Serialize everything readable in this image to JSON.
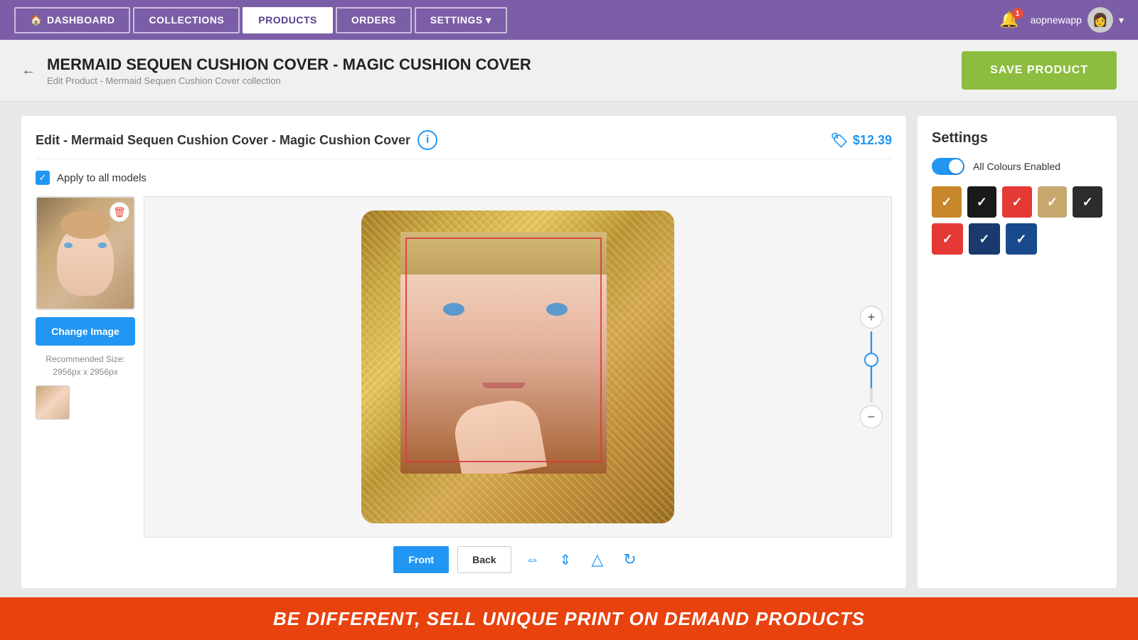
{
  "nav": {
    "items": [
      {
        "label": "DASHBOARD",
        "id": "dashboard",
        "active": false,
        "icon": "🏠"
      },
      {
        "label": "COLLECTIONS",
        "id": "collections",
        "active": false
      },
      {
        "label": "PRODUCTS",
        "id": "products",
        "active": true
      },
      {
        "label": "ORDERS",
        "id": "orders",
        "active": false
      },
      {
        "label": "SETTINGS ▾",
        "id": "settings",
        "active": false
      }
    ],
    "username": "aopnewapp",
    "notification_count": "1"
  },
  "breadcrumb": {
    "title": "MERMAID SEQUEN CUSHION COVER - MAGIC CUSHION COVER",
    "subtitle": "Edit Product - Mermaid Sequen Cushion Cover collection",
    "save_label": "SAVE PRODUCT"
  },
  "editor": {
    "title": "Edit - Mermaid Sequen Cushion Cover - Magic Cushion Cover",
    "price": "$12.39",
    "apply_all_label": "Apply to all models",
    "change_image_label": "Change Image",
    "rec_size_label": "Recommended Size:",
    "rec_size_value": "2956px x 2956px",
    "front_tab": "Front",
    "back_tab": "Back"
  },
  "settings": {
    "title": "Settings",
    "all_colours_label": "All Colours Enabled",
    "colors": [
      {
        "id": "gold",
        "class": "swatch-gold",
        "checked": true
      },
      {
        "id": "black",
        "class": "swatch-black",
        "checked": true
      },
      {
        "id": "red",
        "class": "swatch-red",
        "checked": true
      },
      {
        "id": "tan",
        "class": "swatch-tan",
        "checked": true
      },
      {
        "id": "dark",
        "class": "swatch-dark",
        "checked": true
      },
      {
        "id": "red2",
        "class": "swatch-red2",
        "checked": true
      },
      {
        "id": "navy",
        "class": "swatch-navy",
        "checked": true
      },
      {
        "id": "navy2",
        "class": "swatch-navy2",
        "checked": true
      }
    ]
  },
  "banner": {
    "text": "BE DIFFERENT, SELL UNIQUE PRINT ON DEMAND PRODUCTS"
  },
  "tools": [
    {
      "id": "align-h",
      "icon": "⇔",
      "label": "align-horizontal-icon"
    },
    {
      "id": "align-v",
      "icon": "⇕",
      "label": "align-vertical-icon"
    },
    {
      "id": "flip",
      "icon": "△",
      "label": "flip-icon"
    },
    {
      "id": "rotate",
      "icon": "↻",
      "label": "rotate-icon"
    }
  ]
}
